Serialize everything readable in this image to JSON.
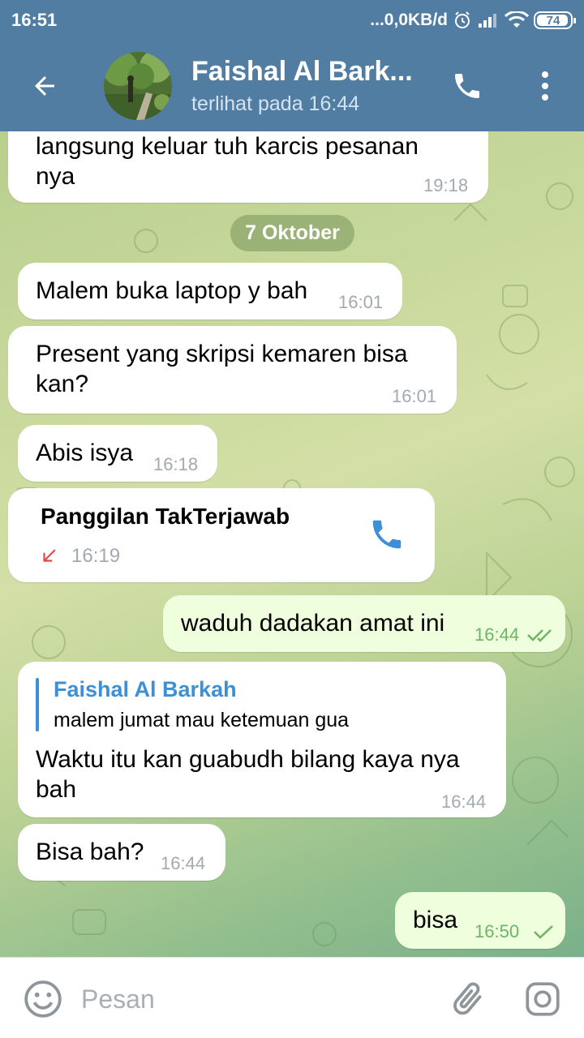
{
  "status_bar": {
    "time": "16:51",
    "network_speed": "...0,0KB/d",
    "battery": "74"
  },
  "header": {
    "contact_name": "Faishal Al Bark...",
    "last_seen": "terlihat pada  16:44",
    "accent_color": "#517da2"
  },
  "messages": [
    {
      "direction": "in",
      "text_line1": "langsung keluar tuh karcis pesanan",
      "text_line2": "nya",
      "time": "19:18"
    },
    {
      "direction": "in",
      "text": "Malem buka laptop y bah",
      "time": "16:01"
    },
    {
      "direction": "in",
      "text_line1": "Present yang skripsi kemaren bisa",
      "text_line2": "kan?",
      "time": "16:01"
    },
    {
      "direction": "in",
      "text": "Abis isya",
      "time": "16:18"
    },
    {
      "direction": "in",
      "type": "missed_call",
      "title": "Panggilan TakTerjawab",
      "time": "16:19"
    },
    {
      "direction": "out",
      "text": "waduh dadakan amat ini",
      "time": "16:44",
      "status": "read"
    },
    {
      "direction": "in",
      "reply_to_name": "Faishal Al Barkah",
      "reply_to_text": "malem jumat mau ketemuan gua",
      "text_line1": "Waktu itu kan guabudh bilang kaya nya",
      "text_line2": "bah",
      "time": "16:44"
    },
    {
      "direction": "in",
      "text": "Bisa bah?",
      "time": "16:44"
    },
    {
      "direction": "out",
      "text": "bisa",
      "time": "16:50",
      "status": "sent"
    }
  ],
  "date_separator": "7 Oktober",
  "input": {
    "placeholder": "Pesan",
    "value": ""
  },
  "icons": {
    "back": "arrow-left-icon",
    "call": "phone-icon",
    "menu": "more-vert-icon",
    "emoji": "smiley-icon",
    "attach": "paperclip-icon",
    "camera": "camera-icon",
    "missed_call": "missed-call-arrow-icon",
    "read_receipt": "double-check-icon",
    "sent_receipt": "single-check-icon"
  }
}
